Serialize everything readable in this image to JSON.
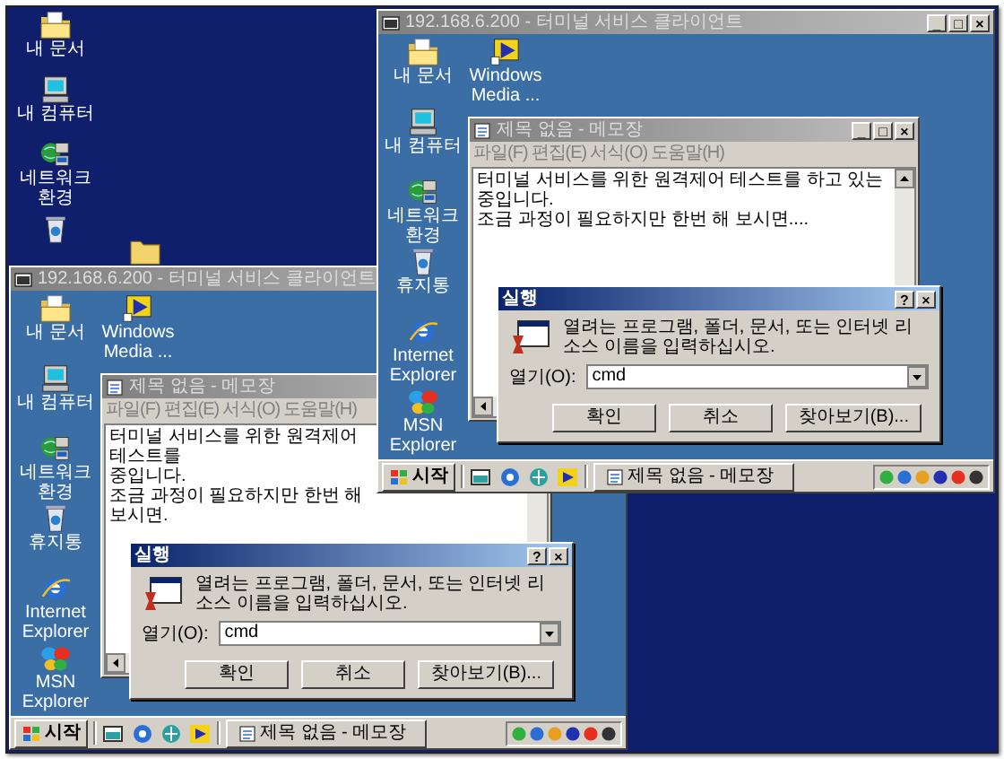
{
  "desktop_icons": [
    {
      "label": "내 문서",
      "kind": "documents"
    },
    {
      "label": "내 컴퓨터",
      "kind": "computer"
    },
    {
      "label": "네트워크 환경",
      "kind": "network"
    },
    {
      "kind": "recycle"
    },
    {
      "kind": "folder"
    }
  ],
  "remote_windows": [
    {
      "title": "192.168.6.200 - 터미널 서비스 클라이언트",
      "title_buttons": [
        "_",
        "□",
        "×"
      ],
      "icons": [
        {
          "label": "내 문서",
          "kind": "documents"
        },
        {
          "label": "Windows Media ...",
          "kind": "media"
        },
        {
          "label": "내 컴퓨터",
          "kind": "computer"
        },
        {
          "label": "네트워크 환경",
          "kind": "network"
        },
        {
          "label": "휴지통",
          "kind": "recycle"
        },
        {
          "label": "Internet Explorer",
          "kind": "ie"
        },
        {
          "label": "MSN Explorer",
          "kind": "msn"
        }
      ],
      "notepad": {
        "title": "제목 없음 - 메모장",
        "title_buttons": [
          "_",
          "□",
          "×"
        ],
        "menu": [
          "파일(F)",
          "편집(E)",
          "서식(O)",
          "도움말(H)"
        ],
        "lines": [
          "터미널 서비스를 위한 원격제어 테스트를 하고 있는",
          "중입니다.",
          "조금 과정이 필요하지만 한번 해 보시면...."
        ]
      },
      "run_dialog": {
        "title": "실행",
        "title_buttons": [
          "?",
          "×"
        ],
        "prompt": "열려는 프로그램, 폴더, 문서, 또는 인터넷 리소스 이름을 입력하십시오.",
        "open_label": "열기(O):",
        "value": "cmd",
        "buttons": [
          "확인",
          "취소",
          "찾아보기(B)..."
        ]
      },
      "taskbar": {
        "start": "시작",
        "tasks": [
          "제목 없음 - 메모장"
        ]
      }
    },
    {
      "title": "192.168.6.200 - 터미널 서비스 클라이언트",
      "icons": [
        {
          "label": "내 문서",
          "kind": "documents"
        },
        {
          "label": "Windows Media ...",
          "kind": "media"
        },
        {
          "label": "내 컴퓨터",
          "kind": "computer"
        },
        {
          "label": "네트워크 환경",
          "kind": "network"
        },
        {
          "label": "휴지통",
          "kind": "recycle"
        },
        {
          "label": "Internet Explorer",
          "kind": "ie"
        },
        {
          "label": "MSN Explorer",
          "kind": "msn"
        }
      ],
      "notepad": {
        "title": "제목 없음 - 메모장",
        "menu": [
          "파일(F)",
          "편집(E)",
          "서식(O)",
          "도움말(H)"
        ],
        "lines": [
          "터미널 서비스를 위한 원격제어 테스트를",
          "중입니다.",
          "조금 과정이 필요하지만 한번 해 보시면."
        ]
      },
      "run_dialog": {
        "title": "실행",
        "title_buttons": [
          "?",
          "×"
        ],
        "prompt": "열려는 프로그램, 폴더, 문서, 또는 인터넷 리소스 이름을 입력하십시오.",
        "open_label": "열기(O):",
        "value": "cmd",
        "buttons": [
          "확인",
          "취소",
          "찾아보기(B)..."
        ]
      },
      "taskbar": {
        "start": "시작",
        "tasks": [
          "제목 없음 - 메모장"
        ]
      }
    }
  ]
}
